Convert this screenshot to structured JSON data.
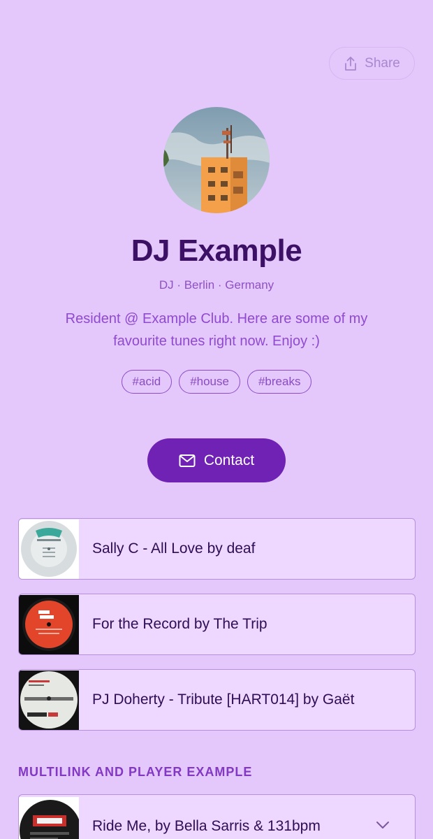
{
  "header": {
    "share_label": "Share",
    "share_icon": "share-icon"
  },
  "profile": {
    "name": "DJ Example",
    "subtitle": "DJ · Berlin · Germany",
    "bio": "Resident @ Example Club. Here are some of my favourite tunes right now. Enjoy :)",
    "tags": [
      "#acid",
      "#house",
      "#breaks"
    ]
  },
  "contact": {
    "label": "Contact",
    "icon": "mail-icon"
  },
  "links": [
    {
      "title": "Sally C - All Love by deaf"
    },
    {
      "title": "For the Record by The Trip"
    },
    {
      "title": "PJ Doherty - Tribute [HART014] by Gaët"
    }
  ],
  "section": {
    "heading": "MULTILINK AND PLAYER EXAMPLE",
    "player_title": "Ride Me, by Bella Sarris & 131bpm"
  },
  "colors": {
    "background": "#e4c8fb",
    "accent": "#6f22b4",
    "name": "#3b1065",
    "card": "#eed8ff"
  }
}
